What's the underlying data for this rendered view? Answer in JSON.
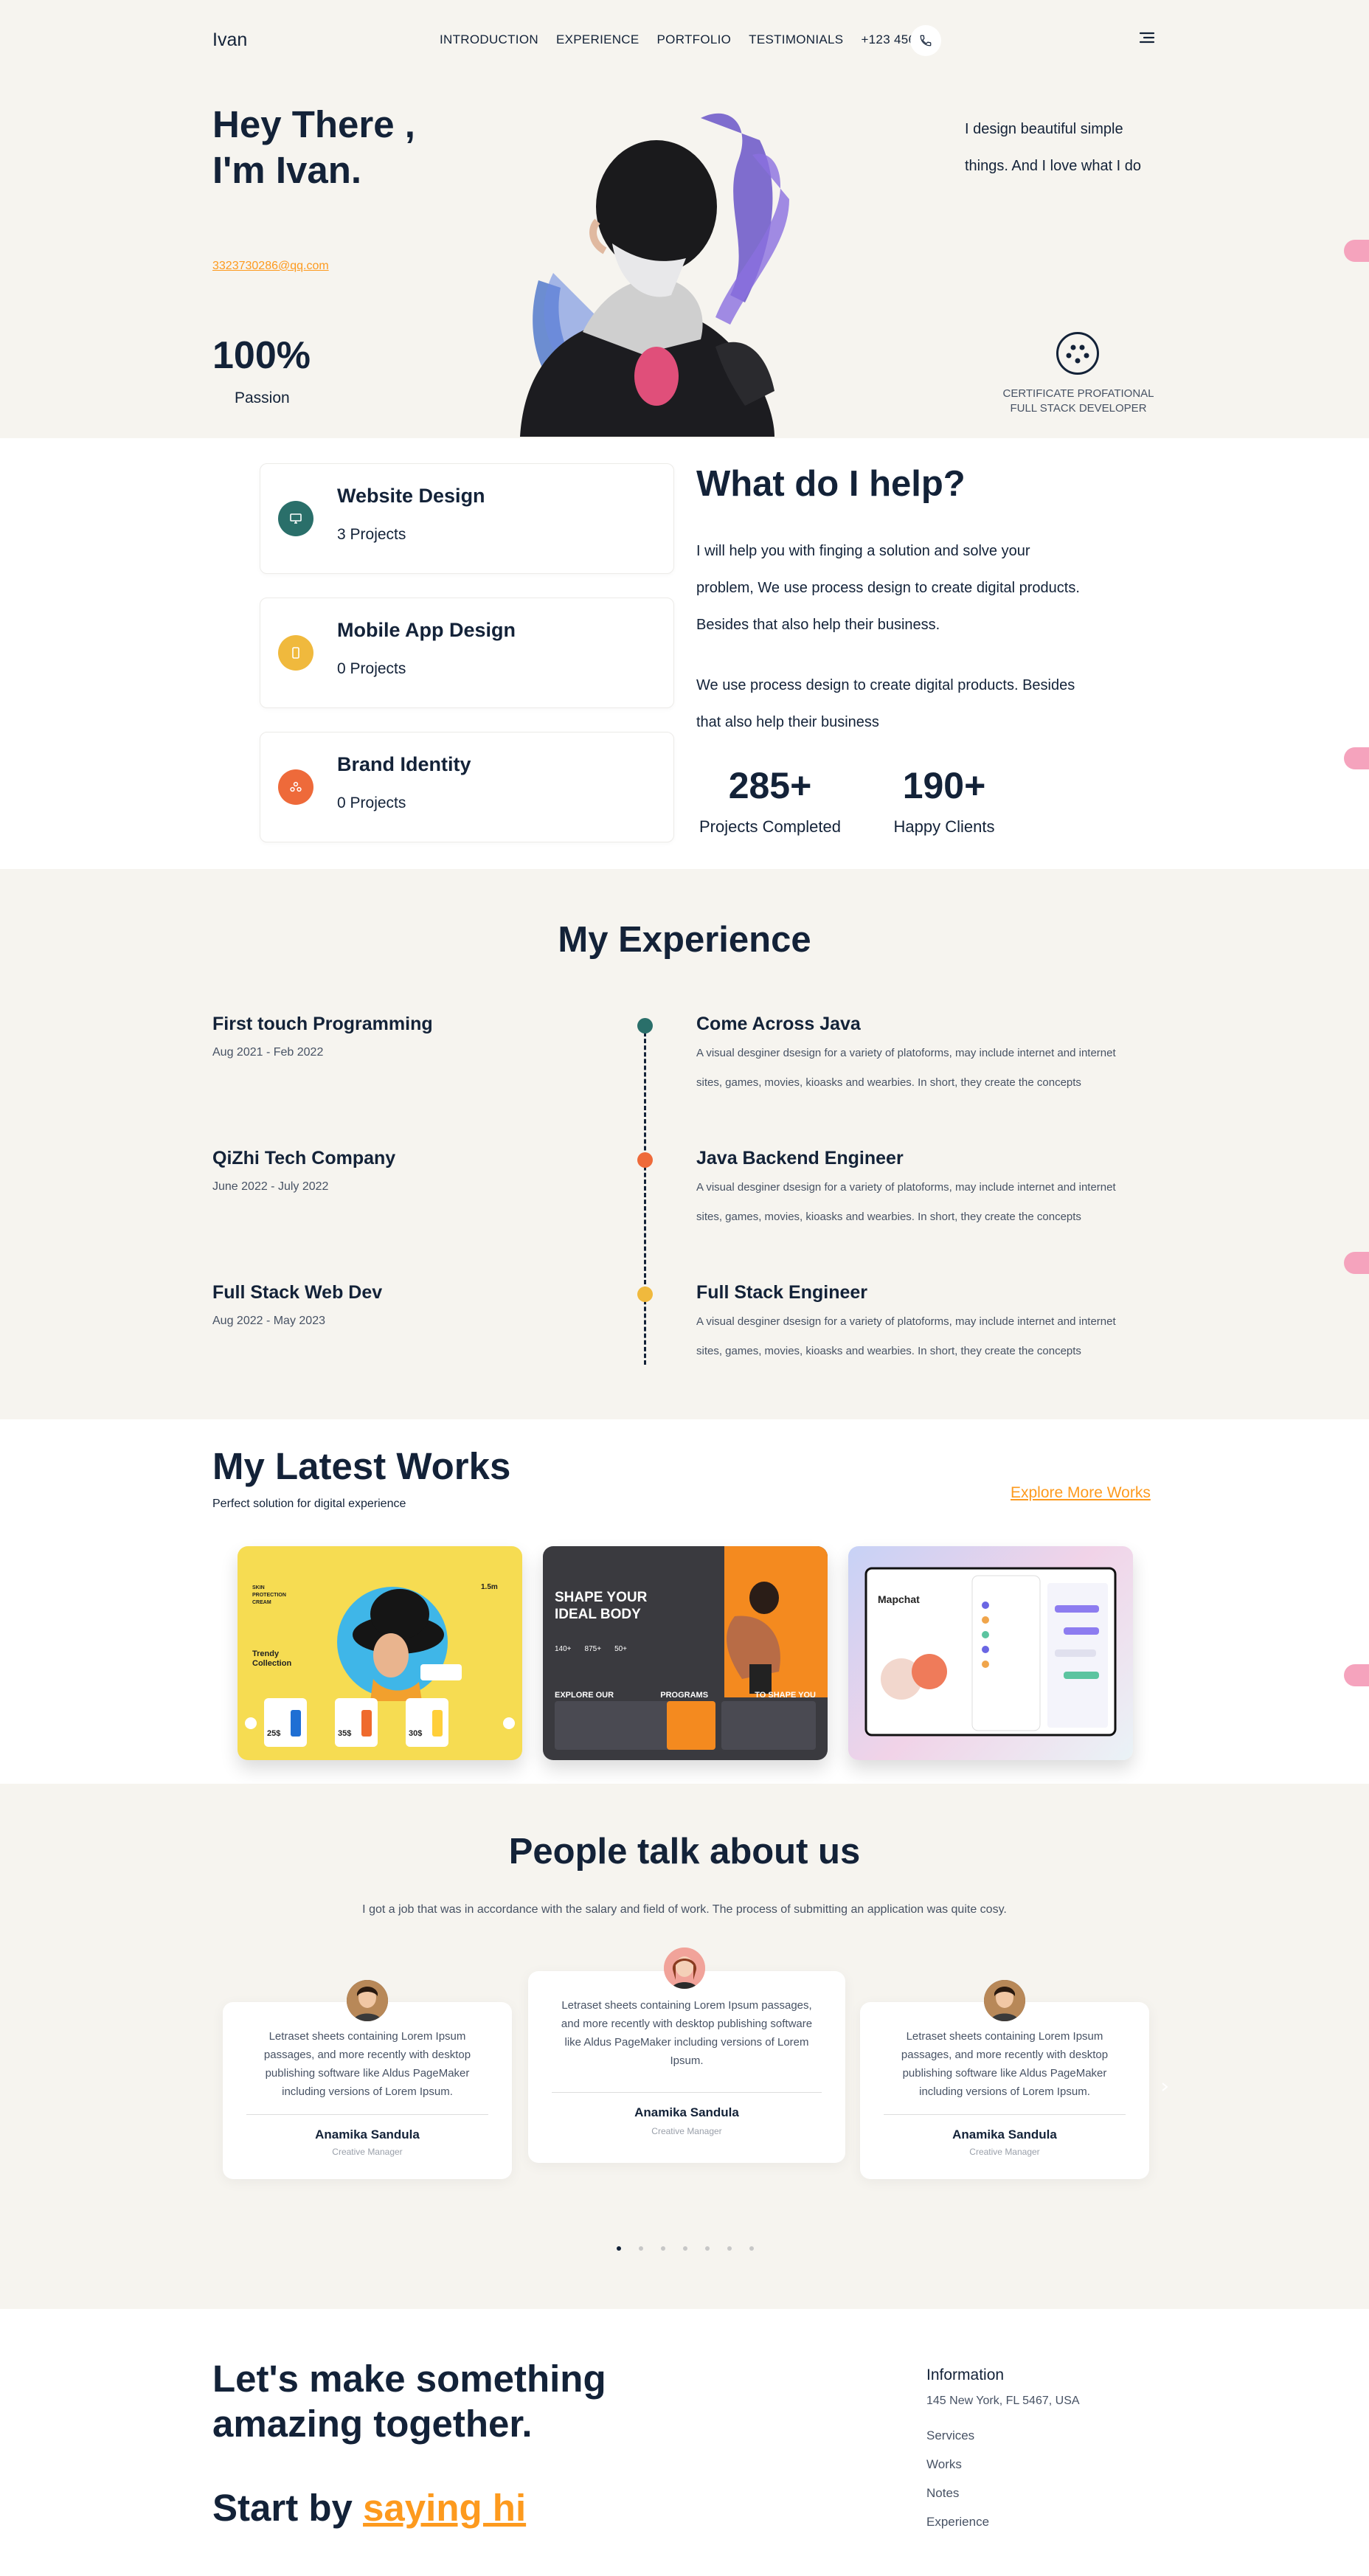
{
  "nav": {
    "logo": "Ivan",
    "links": [
      "INTRODUCTION",
      "EXPERIENCE",
      "PORTFOLIO",
      "TESTIMONIALS"
    ],
    "phone": "+123 456 789"
  },
  "hero": {
    "title_line1": "Hey There ,",
    "title_line2": "I'm Ivan.",
    "email": "3323730286@qq.com",
    "stat_value": "100%",
    "stat_label": "Passion",
    "tagline": "I design beautiful simple things. And I love what I do",
    "cert_line1": "CERTIFICATE PROFATIONAL",
    "cert_line2": "FULL STACK DEVELOPER"
  },
  "services": [
    {
      "title": "Website Design",
      "projects": "3 Projects",
      "color": "#2a6f6a",
      "icon": "monitor-icon"
    },
    {
      "title": "Mobile App Design",
      "projects": "0 Projects",
      "color": "#f0b93d",
      "icon": "mobile-icon"
    },
    {
      "title": "Brand Identity",
      "projects": "0 Projects",
      "color": "#ee6a3a",
      "icon": "brand-icon"
    }
  ],
  "help": {
    "title": "What do I help?",
    "p1": "I will help you with finging a solution and solve your problem, We use process design to create digital products. Besides that also help their business.",
    "p2": "We use process design to create digital products. Besides that also help their business",
    "stat1_value": "285+",
    "stat1_label": "Projects Completed",
    "stat2_value": "190+",
    "stat2_label": "Happy Clients"
  },
  "experience": {
    "title": "My Experience",
    "items": [
      {
        "company": "First touch Programming",
        "date": "Aug 2021 - Feb 2022",
        "role": "Come Across Java",
        "desc": "A visual desginer dsesign for a variety of platoforms, may include internet and internet sites, games, movies, kioasks and wearbies. In short, they create the concepts",
        "color": "#2a6f6a"
      },
      {
        "company": "QiZhi Tech Company",
        "date": "June 2022 - July 2022",
        "role": "Java Backend Engineer",
        "desc": "A visual desginer dsesign for a variety of platoforms, may include internet and internet sites, games, movies, kioasks and wearbies. In short, they create the concepts",
        "color": "#ee6a3a"
      },
      {
        "company": "Full Stack Web Dev",
        "date": "Aug 2022 - May 2023",
        "role": "Full Stack Engineer",
        "desc": "A visual desginer dsesign for a variety of platoforms, may include internet and internet sites, games, movies, kioasks and wearbies. In short, they create the concepts",
        "color": "#f0b93d"
      }
    ]
  },
  "works": {
    "title": "My Latest Works",
    "subtitle": "Perfect solution for digital experience",
    "link": "Explore More Works",
    "card1": {
      "l1": "SKIN",
      "l2": "PROTECTION",
      "l3": "CREAM",
      "heading": "Trendy Collection",
      "price": "1.5m",
      "prices": [
        "25$",
        "35$",
        "30$"
      ]
    },
    "card2": {
      "l1": "SHAPE YOUR",
      "l2": "IDEAL BODY",
      "stats": [
        "140+",
        "875+",
        "50+"
      ],
      "row": [
        "EXPLORE OUR",
        "PROGRAMS",
        "TO SHAPE YOU"
      ]
    },
    "card3": {
      "title": "Mapchat"
    }
  },
  "testimonials": {
    "title": "People talk about us",
    "subtitle": "I got a job that was in accordance with the salary and field of work. The process of submitting an application was quite cosy.",
    "items": [
      {
        "text": "Letraset sheets containing Lorem Ipsum passages, and more recently with desktop publishing software like Aldus PageMaker including versions of Lorem Ipsum.",
        "name": "Anamika Sandula",
        "role": "Creative Manager"
      },
      {
        "text": "Letraset sheets containing Lorem Ipsum passages, and more recently with desktop publishing software like Aldus PageMaker including versions of Lorem Ipsum.",
        "name": "Anamika Sandula",
        "role": "Creative Manager"
      },
      {
        "text": "Letraset sheets containing Lorem Ipsum passages, and more recently with desktop publishing software like Aldus PageMaker including versions of Lorem Ipsum.",
        "name": "Anamika Sandula",
        "role": "Creative Manager"
      }
    ]
  },
  "contact": {
    "title_line1": "Let's make something",
    "title_line2": "amazing together.",
    "start": "Start by",
    "hi": "saying hi",
    "info_title": "Information",
    "address": "145 New York, FL 5467, USA",
    "links": [
      "Services",
      "Works",
      "Notes",
      "Experience"
    ]
  },
  "colors": {
    "accent": "#fd9a1e",
    "dark": "#132238",
    "beige": "#f6f4ef"
  }
}
